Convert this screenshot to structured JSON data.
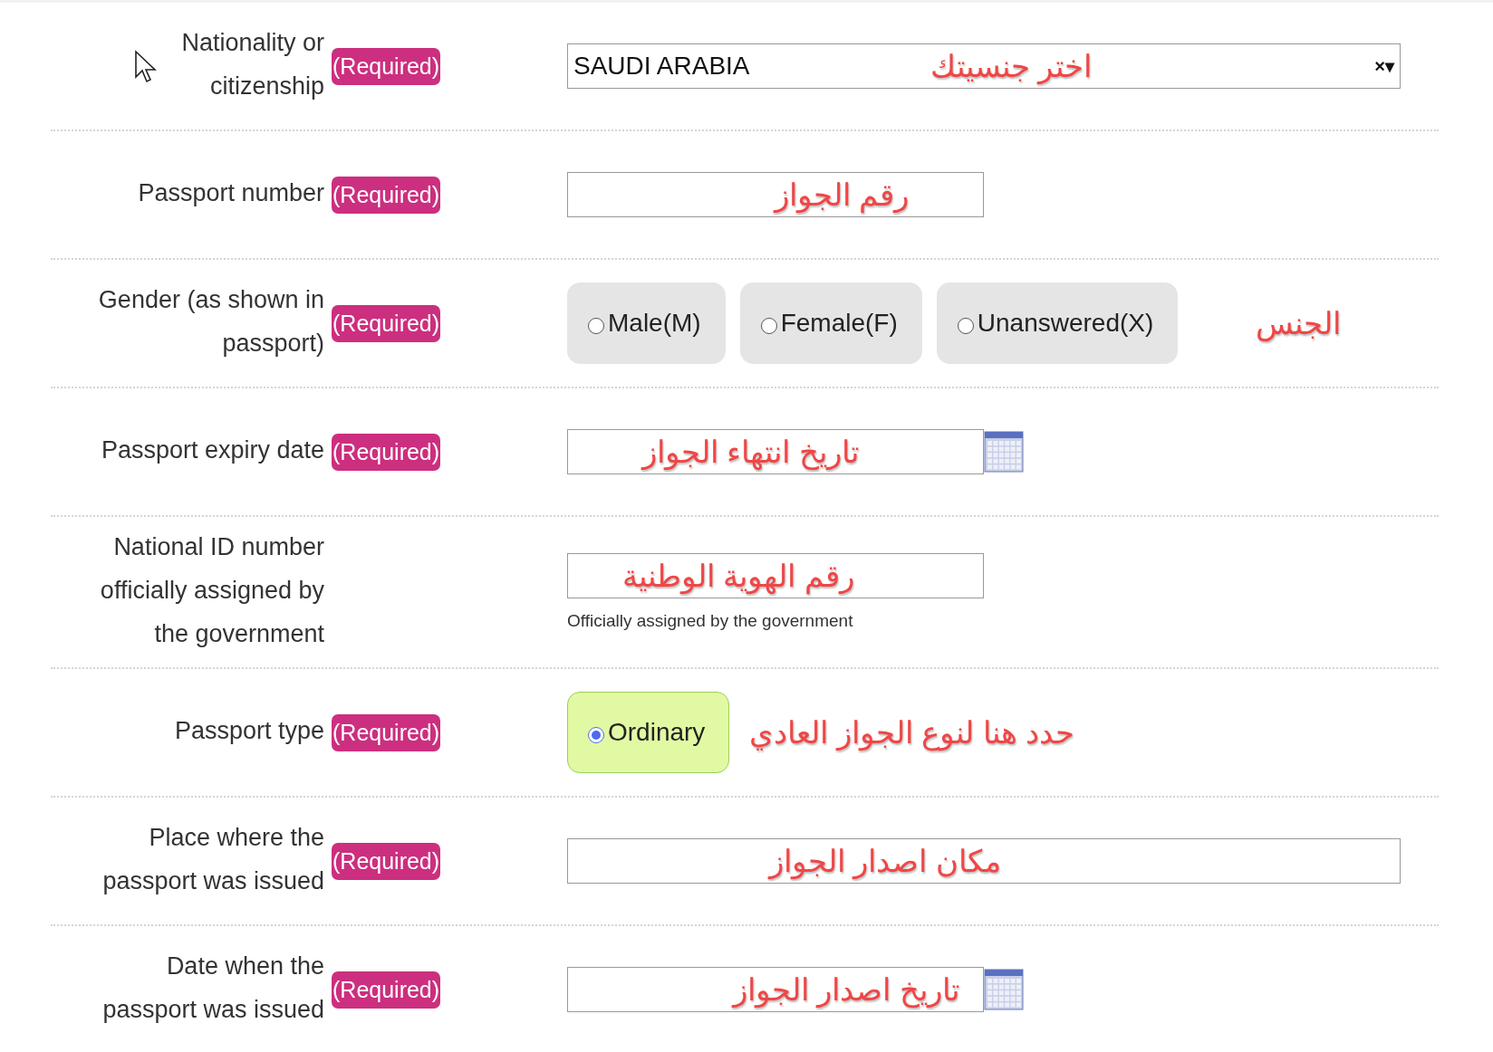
{
  "rows": [
    {
      "kind": "select",
      "label": "Nationality or citizenship",
      "badge": "(Required)",
      "value": "SAUDI ARABIA",
      "clear": "×▾",
      "annotation": "اختر جنسيتك"
    },
    {
      "kind": "text",
      "label": "Passport number",
      "badge": "(Required)",
      "annotation": "رقم الجواز"
    },
    {
      "kind": "radio",
      "label": "Gender (as shown in passport)",
      "badge": "(Required)",
      "options": [
        {
          "label": "Male(M)",
          "selected": false
        },
        {
          "label": "Female(F)",
          "selected": false
        },
        {
          "label": "Unanswered(X)",
          "selected": false
        }
      ],
      "annotation": "الجنس"
    },
    {
      "kind": "date",
      "label": "Passport expiry date",
      "badge": "(Required)",
      "annotation": "تاريخ انتهاء الجواز"
    },
    {
      "kind": "text",
      "label": "National ID number officially assigned by the government",
      "annotation": "رقم الهوية الوطنية",
      "hint": "Officially assigned by the government"
    },
    {
      "kind": "radio",
      "label": "Passport type",
      "badge": "(Required)",
      "options": [
        {
          "label": "Ordinary",
          "selected": true
        }
      ],
      "annotation": "حدد هنا لنوع الجواز العادي"
    },
    {
      "kind": "wide",
      "label": "Place where the passport was issued",
      "badge": "(Required)",
      "annotation": "مكان اصدار الجواز"
    },
    {
      "kind": "date",
      "label": "Date when the passport was issued",
      "badge": "(Required)",
      "annotation": "تاريخ اصدار الجواز"
    }
  ]
}
